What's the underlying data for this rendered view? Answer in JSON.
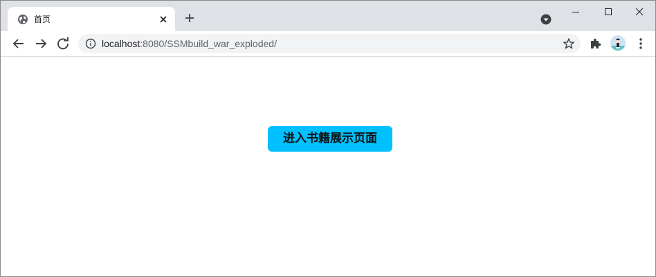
{
  "browser": {
    "tab": {
      "title": "首页",
      "favicon": "globe-icon",
      "close": "close-icon"
    },
    "new_tab": "plus-icon",
    "tab_search": "tab-search-icon",
    "window_controls": [
      "minimize-icon",
      "maximize-icon",
      "close-icon"
    ],
    "toolbar": {
      "back": "arrow-left-icon",
      "forward": "arrow-right-icon",
      "reload": "reload-icon",
      "site_info": "info-icon",
      "url_host": "localhost",
      "url_rest": ":8080/SSMbuild_war_exploded/",
      "bookmark": "star-icon",
      "extensions": "puzzle-icon",
      "profile": "avatar",
      "menu": "kebab-menu-icon"
    }
  },
  "page": {
    "enter_button_label": "进入书籍展示页面"
  },
  "colors": {
    "tabstrip_bg": "#dee1e6",
    "omnibox_bg": "#f1f3f4",
    "button_bg": "#00c0ff",
    "icon": "#5f6368"
  }
}
